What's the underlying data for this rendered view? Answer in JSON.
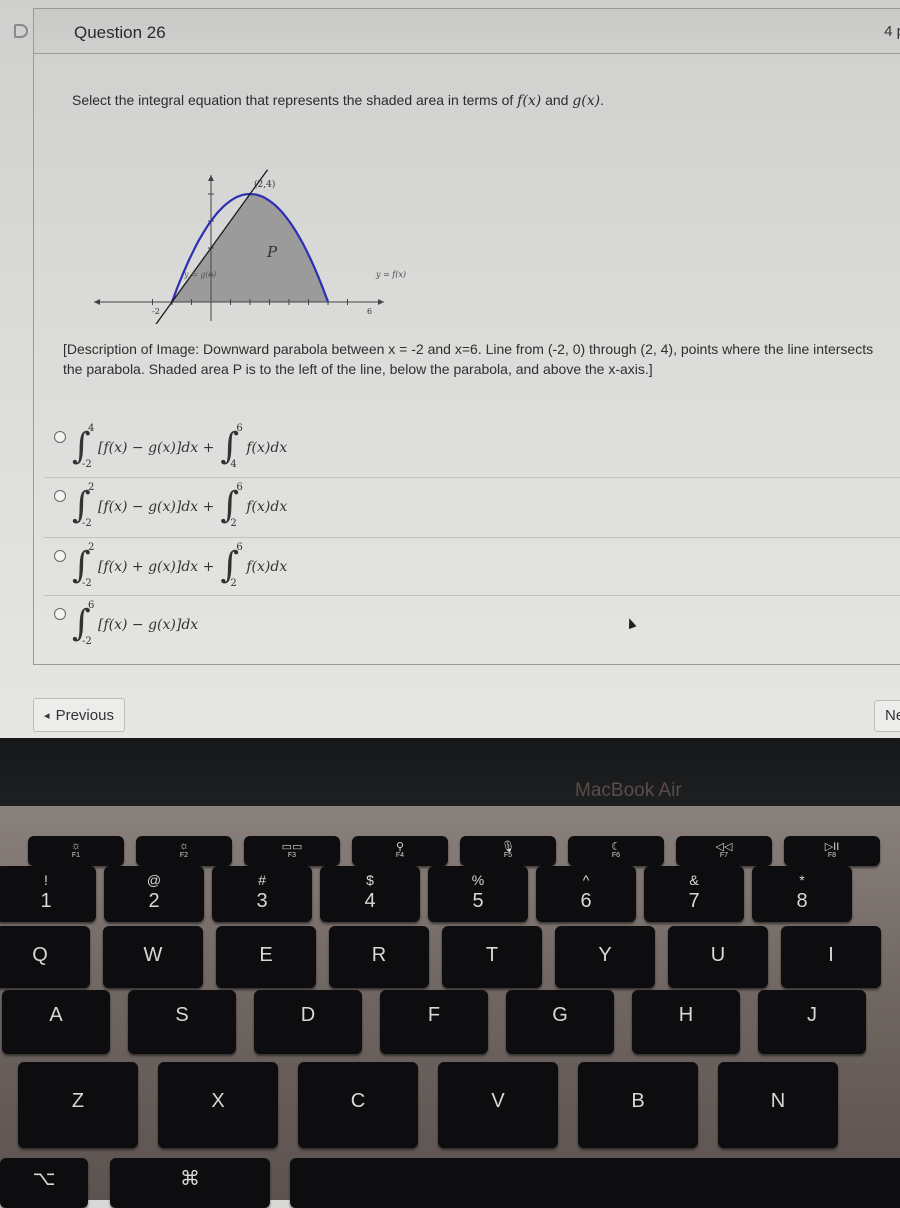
{
  "question": {
    "title": "Question 26",
    "points": "4 p",
    "prompt_prefix": "Select the integral equation that represents the shaded area in terms of ",
    "prompt_f": "f(x)",
    "prompt_and": " and ",
    "prompt_g": "g(x)",
    "prompt_suffix": ".",
    "description": "[Description of Image: Downward parabola between x = -2 and x=6. Line from (-2, 0) through (2, 4), points where the line intersects the parabola. Shaded area P is to the left of the line, below the parabola, and above the x-axis.]"
  },
  "graph": {
    "point_label": "(2,4)",
    "region_label": "P",
    "line_label": "y = g(x)",
    "curve_label": "y = f(x)",
    "x_left_label": "-2",
    "x_right_label": "6",
    "curve_color": "#2b2fb0",
    "line_color": "#1a1a1a",
    "shade_color": "#9b9b9b"
  },
  "options": [
    {
      "int1_upper": "4",
      "int1_lower": "-2",
      "int1_body": "[f(x) − g(x)]dx +",
      "int2_upper": "6",
      "int2_lower": "4",
      "int2_body": "f(x)dx"
    },
    {
      "int1_upper": "2",
      "int1_lower": "-2",
      "int1_body": "[f(x) − g(x)]dx +",
      "int2_upper": "6",
      "int2_lower": "2",
      "int2_body": "f(x)dx"
    },
    {
      "int1_upper": "2",
      "int1_lower": "-2",
      "int1_body": "[f(x) + g(x)]dx +",
      "int2_upper": "6",
      "int2_lower": "2",
      "int2_body": "f(x)dx"
    },
    {
      "int1_upper": "6",
      "int1_lower": "-2",
      "int1_body": "[f(x) − g(x)]dx"
    }
  ],
  "nav": {
    "prev_arrow": "◂",
    "prev_label": "Previous",
    "next_label": "Ne"
  },
  "laptop": {
    "brand": "MacBook Air",
    "fn_keys": [
      {
        "icon": "☼",
        "label": "F1"
      },
      {
        "icon": "☼",
        "label": "F2"
      },
      {
        "icon": "▭▭",
        "label": "F3"
      },
      {
        "icon": "⚲",
        "label": "F4"
      },
      {
        "icon": "🎙",
        "label": "F5"
      },
      {
        "icon": "☾",
        "label": "F6"
      },
      {
        "icon": "◁◁",
        "label": "F7"
      },
      {
        "icon": "▷II",
        "label": "F8"
      }
    ],
    "num_keys": [
      {
        "sub": "!",
        "main": "1"
      },
      {
        "sub": "@",
        "main": "2"
      },
      {
        "sub": "#",
        "main": "3"
      },
      {
        "sub": "$",
        "main": "4"
      },
      {
        "sub": "%",
        "main": "5"
      },
      {
        "sub": "^",
        "main": "6"
      },
      {
        "sub": "&",
        "main": "7"
      },
      {
        "sub": "*",
        "main": "8"
      }
    ],
    "row_q": [
      "Q",
      "W",
      "E",
      "R",
      "T",
      "Y",
      "U",
      "I"
    ],
    "row_a": [
      "A",
      "S",
      "D",
      "F",
      "G",
      "H",
      "J"
    ],
    "row_z": [
      "Z",
      "X",
      "C",
      "V",
      "B",
      "N"
    ],
    "option_key": "⌥",
    "command_key": "⌘"
  }
}
